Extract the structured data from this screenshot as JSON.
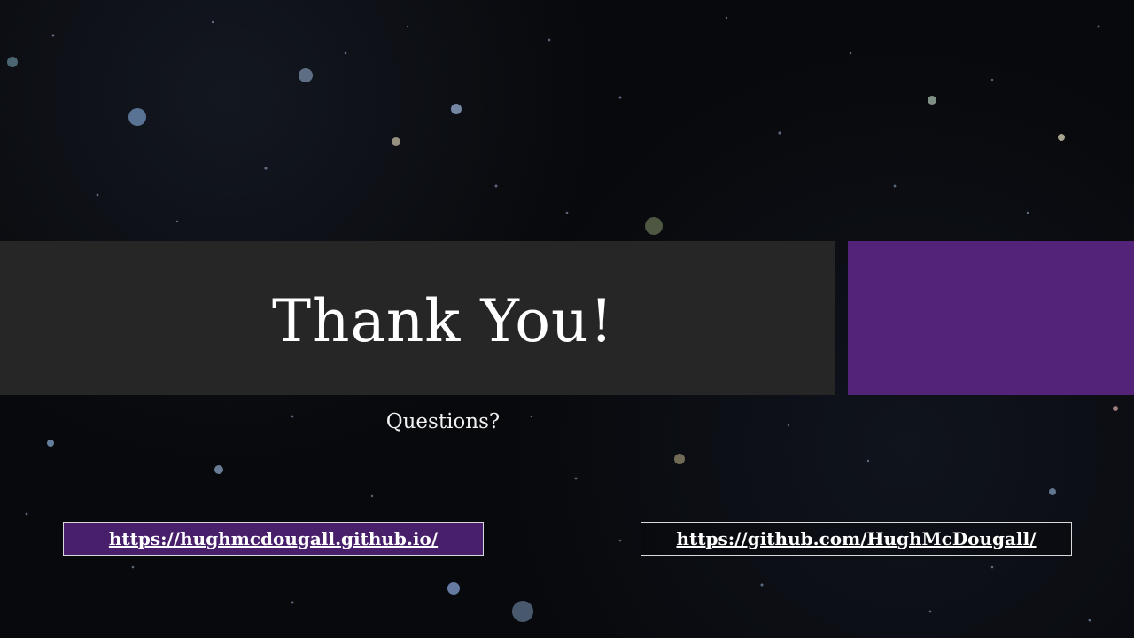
{
  "slide": {
    "title": "Thank You!",
    "subtitle": "Questions?",
    "links": {
      "personal_site": "https://hughmcdougall.github.io/",
      "github": "https://github.com/HughMcDougall/"
    }
  },
  "colors": {
    "background": "#08090c",
    "title_band": "#262626",
    "accent": "#53237a",
    "text": "#ffffff"
  }
}
